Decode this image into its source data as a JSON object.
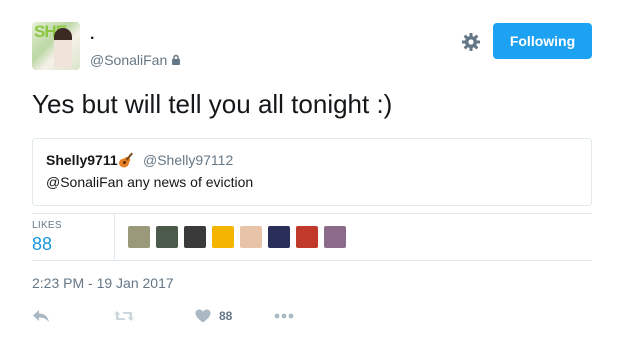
{
  "tweet": {
    "author": {
      "display_name": ".",
      "handle": "@SonaliFan",
      "avatar_text": "SHE",
      "protected_icon": "lock-icon"
    },
    "follow_button_label": "Following",
    "settings_icon": "gear-icon",
    "text": "Yes but will tell you all tonight :)",
    "quoted": {
      "author_name": "Shelly9711",
      "emoji": "guitar-emoji",
      "handle": "@Shelly97112",
      "text": "@SonaliFan any news of eviction"
    },
    "stats": {
      "likes_label": "LIKES",
      "likes_count": "88"
    },
    "likers": [
      {
        "name": "liker-1",
        "color": "#9a9a7a"
      },
      {
        "name": "liker-2",
        "color": "#4b5a4a"
      },
      {
        "name": "liker-3",
        "color": "#3a3a3a"
      },
      {
        "name": "liker-4",
        "color": "#f4b400"
      },
      {
        "name": "liker-5",
        "color": "#e8c3a8"
      },
      {
        "name": "liker-6",
        "color": "#2a2f5a"
      },
      {
        "name": "liker-7",
        "color": "#c0392b"
      },
      {
        "name": "liker-8",
        "color": "#8a6b8a"
      }
    ],
    "timestamp": "2:23 PM - 19 Jan 2017",
    "actions": {
      "reply_icon": "reply-icon",
      "retweet_icon": "retweet-icon",
      "like_icon": "heart-icon",
      "like_count": "88",
      "more_icon": "more-icon"
    }
  },
  "colors": {
    "accent": "#1da1f2",
    "muted": "#657786",
    "border": "#e1e8ed",
    "count_blue": "#1b95e0"
  }
}
